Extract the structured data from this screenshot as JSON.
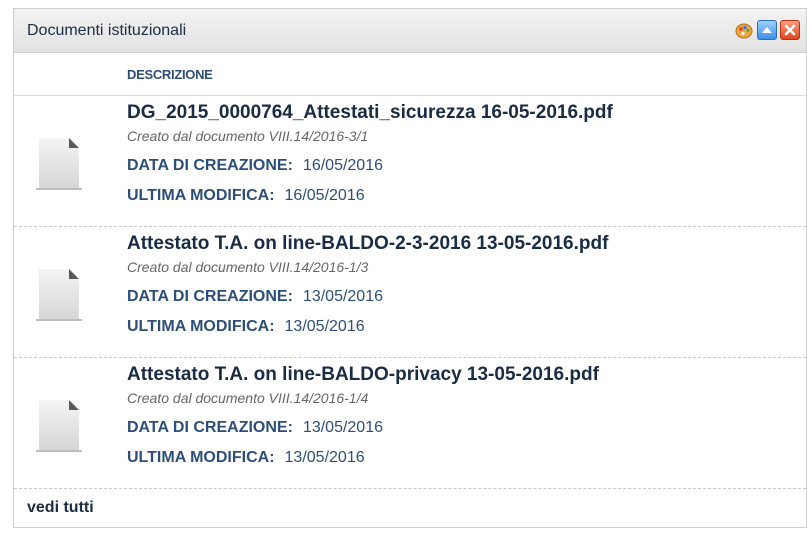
{
  "portlet": {
    "title": "Documenti istituzionali"
  },
  "table": {
    "column_description": "DESCRIZIONE"
  },
  "labels": {
    "created": "DATA DI CREAZIONE:",
    "modified": "ULTIMA MODIFICA:"
  },
  "documents": [
    {
      "title": "DG_2015_0000764_Attestati_sicurezza 16-05-2016.pdf",
      "source": "Creato dal documento VIII.14/2016-3/1",
      "created": "16/05/2016",
      "modified": "16/05/2016"
    },
    {
      "title": "Attestato T.A. on line-BALDO-2-3-2016 13-05-2016.pdf",
      "source": "Creato dal documento VIII.14/2016-1/3",
      "created": "13/05/2016",
      "modified": "13/05/2016"
    },
    {
      "title": "Attestato T.A. on line-BALDO-privacy 13-05-2016.pdf",
      "source": "Creato dal documento VIII.14/2016-1/4",
      "created": "13/05/2016",
      "modified": "13/05/2016"
    }
  ],
  "footer": {
    "see_all": "vedi tutti"
  },
  "icons": {
    "controls": [
      "palette-icon",
      "collapse-icon",
      "close-icon"
    ],
    "document": "document-icon"
  }
}
